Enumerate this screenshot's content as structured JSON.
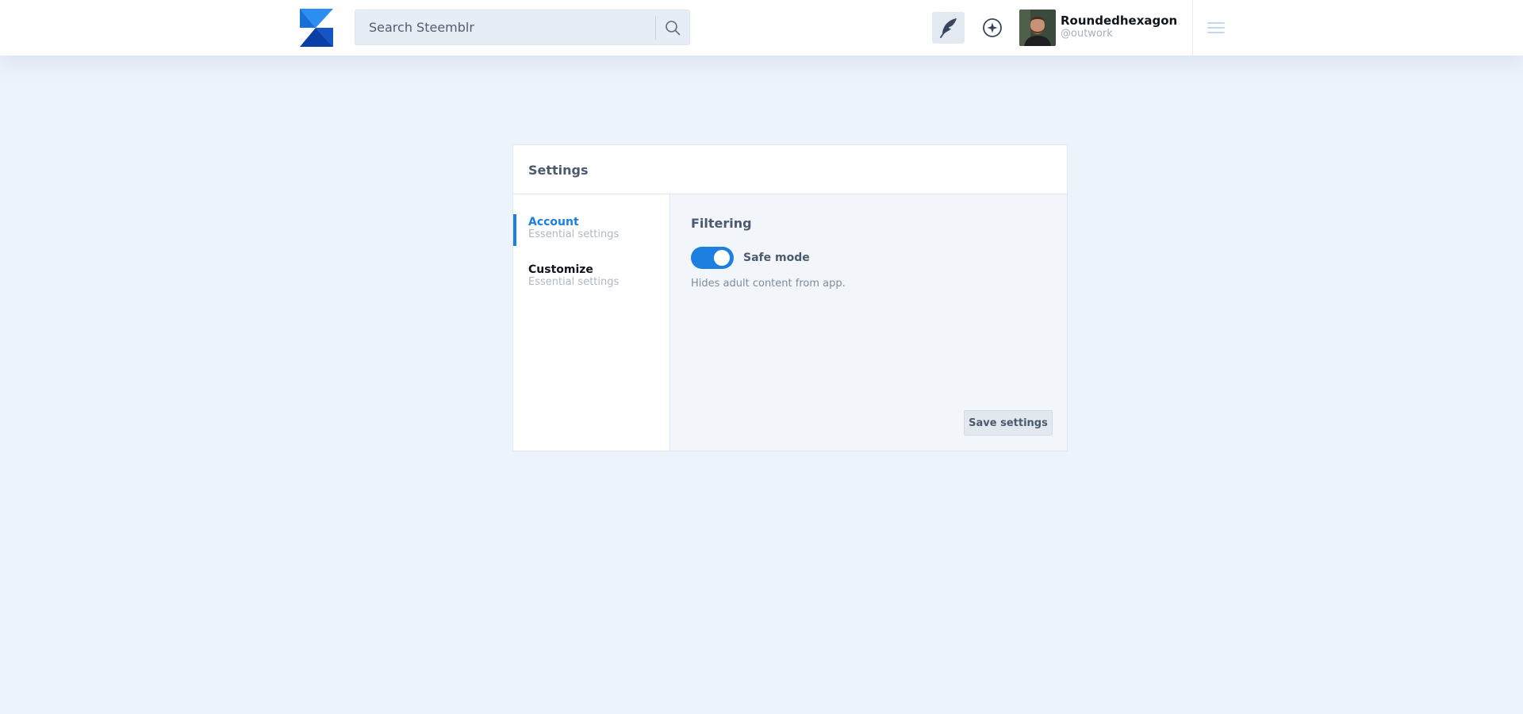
{
  "header": {
    "logo_icon": "steemblr-logo-icon",
    "search": {
      "placeholder": "Search Steemblr",
      "value": "",
      "icon": "search-icon"
    },
    "write_icon": "feather-icon",
    "explore_icon": "compass-icon",
    "user": {
      "name": "Roundedhexagon",
      "handle": "@outwork",
      "avatar_icon": "avatar-photo"
    },
    "menu_icon": "hamburger-icon"
  },
  "settings": {
    "title": "Settings",
    "sidebar": {
      "items": [
        {
          "label": "Account",
          "sublabel": "Essential settings",
          "active": true
        },
        {
          "label": "Customize",
          "sublabel": "Essential settings",
          "active": false
        }
      ]
    },
    "panel": {
      "section_title": "Filtering",
      "toggle": {
        "label": "Safe mode",
        "enabled": true,
        "description": "Hides adult content from app."
      },
      "save_label": "Save settings"
    }
  },
  "colors": {
    "accent": "#1d7fe0",
    "page_background": "#edf3fa",
    "panel_background": "#f2f6fa",
    "logo_light": "#2b8ef0",
    "logo_dark": "#0b3fa8"
  }
}
